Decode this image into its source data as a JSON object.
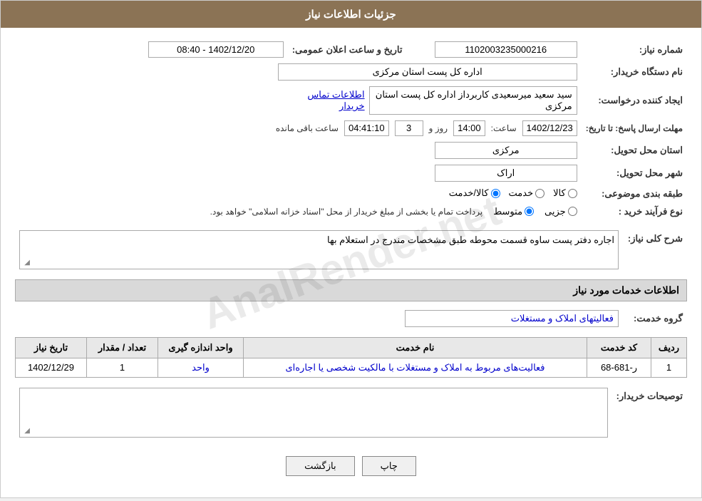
{
  "page": {
    "title": "جزئیات اطلاعات نیاز"
  },
  "header": {
    "title": "جزئیات اطلاعات نیاز"
  },
  "form": {
    "need_number_label": "شماره نیاز:",
    "need_number_value": "1102003235000216",
    "buyer_org_label": "نام دستگاه خریدار:",
    "buyer_org_value": "اداره کل پست استان مرکزی",
    "date_label": "تاریخ و ساعت اعلان عمومی:",
    "date_value": "1402/12/20 - 08:40",
    "creator_label": "ایجاد کننده درخواست:",
    "creator_value": "سید سعید میرسعیدی کاربرداز اداره کل پست استان مرکزی",
    "contact_link": "اطلاعات تماس خریدار",
    "deadline_label": "مهلت ارسال پاسخ: تا تاریخ:",
    "deadline_date": "1402/12/23",
    "deadline_time_label": "ساعت:",
    "deadline_time": "14:00",
    "deadline_day_label": "روز و",
    "deadline_day": "3",
    "deadline_remaining_label": "ساعت باقی مانده",
    "deadline_remaining": "04:41:10",
    "province_label": "استان محل تحویل:",
    "province_value": "مرکزی",
    "city_label": "شهر محل تحویل:",
    "city_value": "اراک",
    "category_label": "طبقه بندی موضوعی:",
    "category_kala": "کالا",
    "category_khedmat": "خدمت",
    "category_kala_khedmat": "کالا/خدمت",
    "category_selected": "کالا/خدمت",
    "purchase_type_label": "نوع فرآیند خرید :",
    "purchase_type_jozi": "جزیی",
    "purchase_type_motavasset": "متوسط",
    "purchase_type_text": "پرداخت تمام یا بخشی از مبلغ خریدار از محل \"اسناد خزانه اسلامی\" خواهد بود.",
    "description_label": "شرح کلی نیاز:",
    "description_value": "اجاره دفتر پست ساوه قسمت محوطه  طبق مشخصات مندرج در استعلام بها"
  },
  "services_section": {
    "title": "اطلاعات خدمات مورد نیاز",
    "group_label": "گروه خدمت:",
    "group_value": "فعالیتهای  املاک و مستغلات",
    "table": {
      "headers": [
        "ردیف",
        "کد خدمت",
        "نام خدمت",
        "واحد اندازه گیری",
        "تعداد / مقدار",
        "تاریخ نیاز"
      ],
      "rows": [
        {
          "row": "1",
          "code": "ر-681-68",
          "name": "فعالیت‌های مربوط به املاک و مستغلات با مالکیت شخصی یا اجاره‌ای",
          "unit": "واحد",
          "count": "1",
          "date": "1402/12/29"
        }
      ]
    }
  },
  "buyer_desc": {
    "label": "توصیحات خریدار:"
  },
  "buttons": {
    "print": "چاپ",
    "back": "بازگشت"
  }
}
